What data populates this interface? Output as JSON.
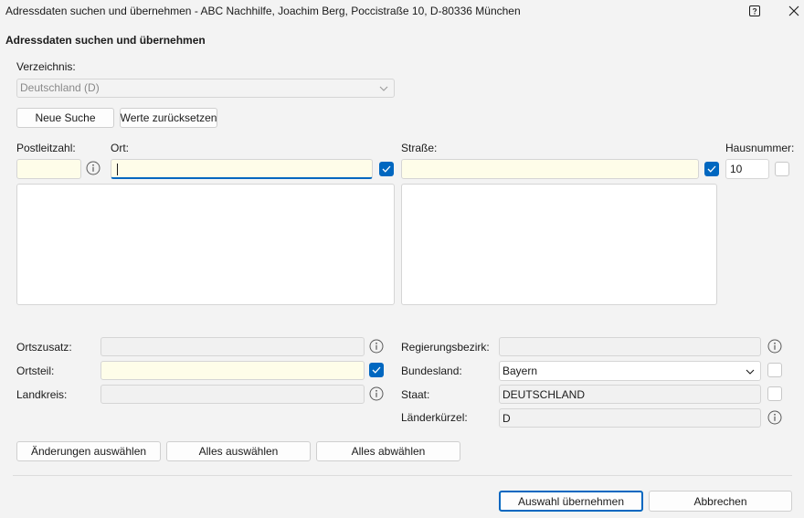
{
  "window": {
    "title": "Adressdaten suchen und übernehmen - ABC Nachhilfe, Joachim Berg, Poccistraße 10, D-80336 München",
    "help_icon": "help-icon",
    "close_icon": "close-icon"
  },
  "heading": "Adressdaten suchen und übernehmen",
  "directory": {
    "label": "Verzeichnis:",
    "value": "Deutschland (D)"
  },
  "buttons": {
    "new_search": "Neue Suche",
    "reset_values": "Werte zurücksetzen",
    "select_changes": "Änderungen auswählen",
    "select_all": "Alles auswählen",
    "deselect_all": "Alles abwählen",
    "apply_selection": "Auswahl übernehmen",
    "cancel": "Abbrechen"
  },
  "search": {
    "postal_code_label": "Postleitzahl:",
    "postal_code_value": "",
    "city_label": "Ort:",
    "city_value": "",
    "city_checked": true,
    "street_label": "Straße:",
    "street_value": "",
    "street_checked": true,
    "house_number_label": "Hausnummer:",
    "house_number_value": "10",
    "house_number_checked": false
  },
  "details": {
    "locality_suffix_label": "Ortszusatz:",
    "locality_suffix_value": "",
    "district_label": "Ortsteil:",
    "district_value": "",
    "district_checked": true,
    "county_label": "Landkreis:",
    "county_value": "",
    "administrative_region_label": "Regierungsbezirk:",
    "administrative_region_value": "",
    "state_label": "Bundesland:",
    "state_value": "Bayern",
    "state_checked": false,
    "country_label": "Staat:",
    "country_value": "DEUTSCHLAND",
    "country_checked": false,
    "country_code_label": "Länderkürzel:",
    "country_code_value": "D"
  },
  "colors": {
    "accent": "#0067c0",
    "required_field_background": "#fefde9",
    "window_background": "#f3f3f3"
  }
}
